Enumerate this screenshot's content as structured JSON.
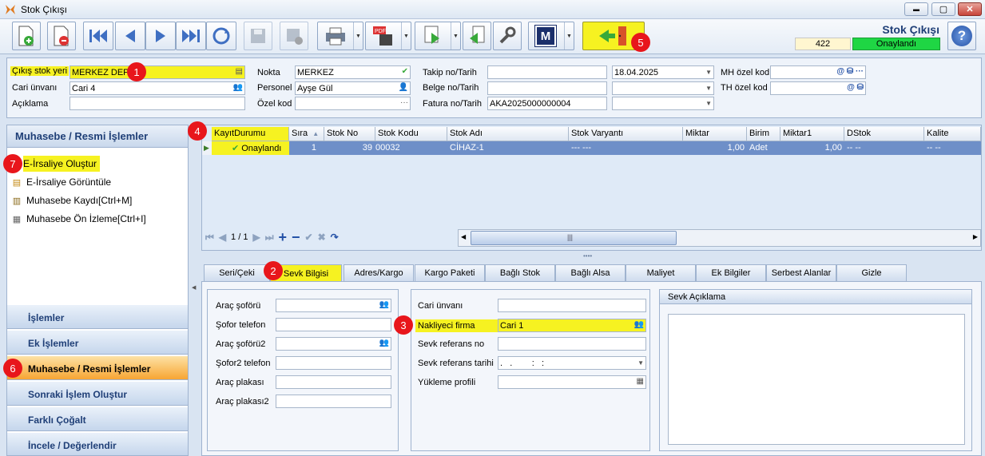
{
  "window": {
    "title": "Stok Çıkışı",
    "min": "▬",
    "max": "▢",
    "close": "✕"
  },
  "toolbar": {
    "doc_title": "Stok Çıkışı",
    "doc_no": "422",
    "status": "Onaylandı",
    "help": "?",
    "m_label": "M"
  },
  "header": {
    "cikis_stok_yeri_label": "Çıkış stok yeri",
    "cikis_stok_yeri_value": "MERKEZ DEPO",
    "cari_unvani_label": "Cari ünvanı",
    "cari_unvani_value": "Cari 4",
    "aciklama_label": "Açıklama",
    "aciklama_value": "",
    "nokta_label": "Nokta",
    "nokta_value": "MERKEZ",
    "personel_label": "Personel",
    "personel_value": "Ayşe Gül",
    "ozel_kod_label": "Özel kod",
    "ozel_kod_value": "",
    "takip_label": "Takip no/Tarih",
    "takip_value": "",
    "takip_date": "18.04.2025",
    "belge_label": "Belge no/Tarih",
    "belge_value": "",
    "fatura_label": "Fatura no/Tarih",
    "fatura_value": "AKA2025000000004",
    "mh_label": "MH özel kod",
    "th_label": "TH özel kod"
  },
  "left_panel": {
    "header": "Muhasebe / Resmi İşlemler",
    "items": [
      {
        "label": "E-İrsaliye Oluştur"
      },
      {
        "label": "E-İrsaliye Görüntüle"
      },
      {
        "label": "Muhasebe Kaydı[Ctrl+M]"
      },
      {
        "label": "Muhasebe Ön İzleme[Ctrl+I]"
      }
    ],
    "nav": [
      {
        "label": "İşlemler"
      },
      {
        "label": "Ek İşlemler"
      },
      {
        "label": "Muhasebe / Resmi İşlemler"
      },
      {
        "label": "Sonraki İşlem Oluştur"
      },
      {
        "label": "Farklı Çoğalt"
      },
      {
        "label": "İncele / Değerlendir"
      }
    ]
  },
  "grid": {
    "columns": [
      "KayıtDurumu",
      "Sıra",
      "Stok No",
      "Stok Kodu",
      "Stok Adı",
      "Stok Varyantı",
      "Miktar",
      "Birim",
      "Miktar1",
      "DStok",
      "Kalite"
    ],
    "row": {
      "durum": "Onaylandı",
      "sira": "1",
      "stok_no": "39",
      "stok_kodu": "00032",
      "stok_adi": "CİHAZ-1",
      "varyant": "--- ---",
      "miktar": "1,00",
      "birim": "Adet",
      "miktar1": "1,00",
      "dstok": "-- --",
      "kalite": "-- --"
    },
    "page": "1 / 1",
    "scroll_grip": "|||"
  },
  "tabs": [
    "Seri/Çeki",
    "Sevk Bilgisi",
    "Adres/Kargo",
    "Kargo Paketi",
    "Bağlı Stok",
    "Bağlı Alsa",
    "Maliyet",
    "Ek Bilgiler",
    "Serbest Alanlar",
    "Gizle"
  ],
  "sevk": {
    "arac_soforu": "Araç şoförü",
    "sofor_telefon": "Şofor telefon",
    "arac_soforu2": "Araç şoförü2",
    "sofor2_telefon": "Şofor2 telefon",
    "arac_plakasi": "Araç plakası",
    "arac_plakasi2": "Araç plakası2",
    "cari_unvani": "Cari ünvanı",
    "nakliyeci_firma": "Nakliyeci firma",
    "nakliyeci_value": "Cari 1",
    "sevk_referans_no": "Sevk referans no",
    "sevk_referans_tarihi": "Sevk referans tarihi",
    "sevk_tarih_value": ".   .        :   :",
    "yukleme_profili": "Yükleme profili",
    "sevk_aciklama": "Sevk Açıklama"
  },
  "markers": [
    "1",
    "2",
    "3",
    "4",
    "5",
    "6",
    "7"
  ]
}
